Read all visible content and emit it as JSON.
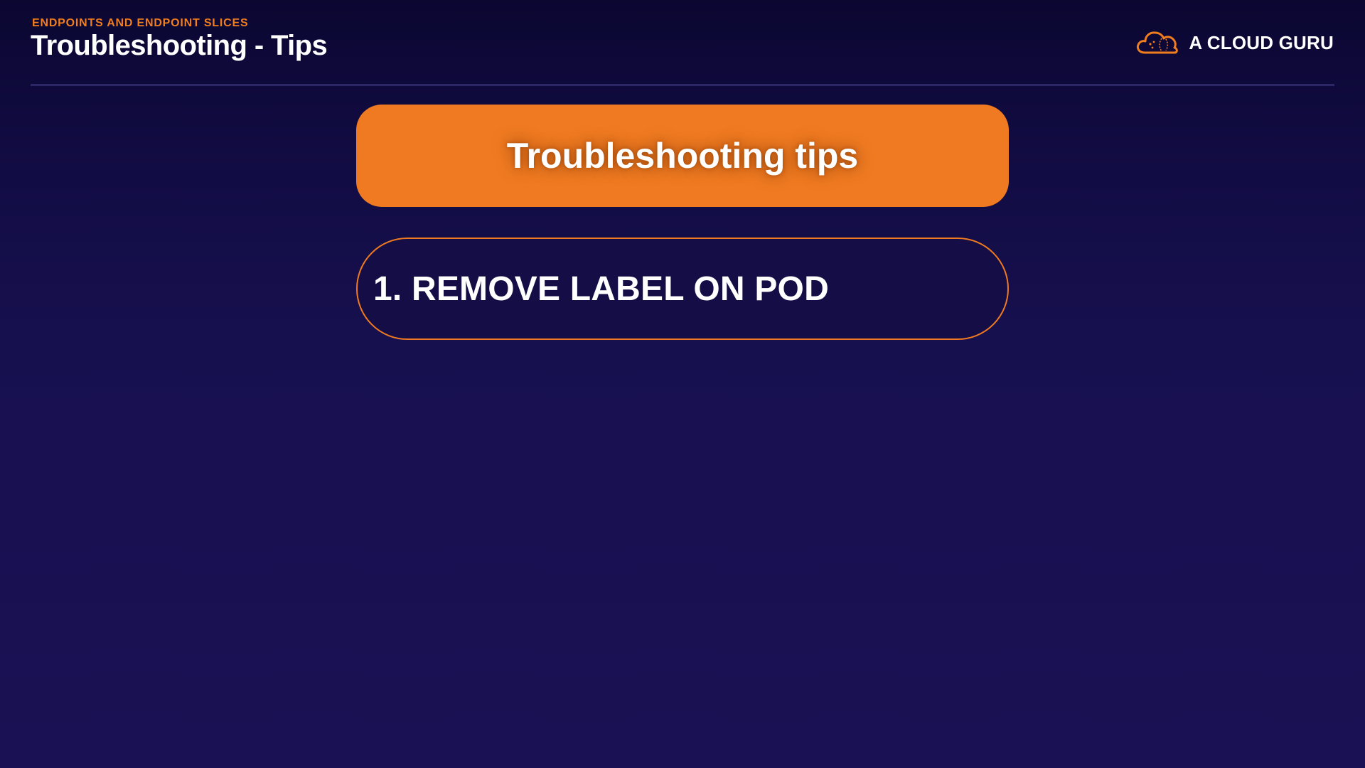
{
  "header": {
    "kicker": "ENDPOINTS AND ENDPOINT SLICES",
    "title": "Troubleshooting - Tips"
  },
  "brand": {
    "name": "A CLOUD GURU",
    "icon": "cloud-logo-icon",
    "accent_color": "#f07d1e"
  },
  "banner": {
    "title": "Troubleshooting tips",
    "color": "#ef7a21"
  },
  "tips": [
    {
      "label": "1. REMOVE LABEL ON POD"
    }
  ],
  "colors": {
    "background_top": "#0b0731",
    "background_bottom": "#1a1154",
    "text": "#ffffff"
  }
}
